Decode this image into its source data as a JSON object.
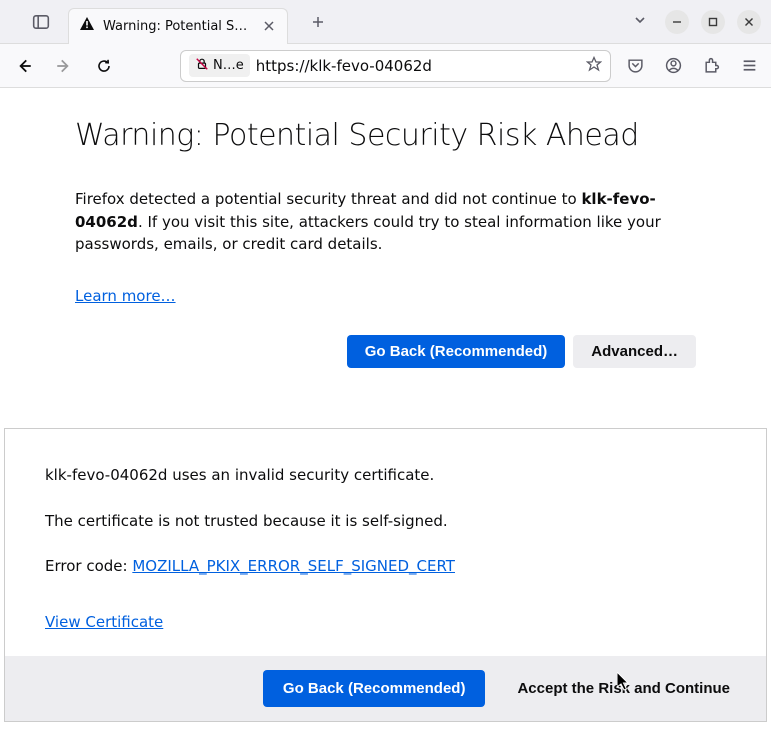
{
  "tab": {
    "title": "Warning: Potential Secur"
  },
  "urlbar": {
    "identity": "N…e",
    "url": "https://klk-fevo-04062d"
  },
  "page": {
    "heading": "Warning: Potential Security Risk Ahead",
    "desc_prefix": "Firefox detected a potential security threat and did not continue to ",
    "desc_host": "klk-fevo-04062d",
    "desc_suffix": ". If you visit this site, attackers could try to steal information like your passwords, emails, or credit card details.",
    "learn_more": "Learn more…",
    "go_back": "Go Back (Recommended)",
    "advanced": "Advanced…"
  },
  "adv": {
    "line1": "klk-fevo-04062d uses an invalid security certificate.",
    "line2": "The certificate is not trusted because it is self-signed.",
    "error_label": "Error code: ",
    "error_code": "MOZILLA_PKIX_ERROR_SELF_SIGNED_CERT",
    "view_cert": "View Certificate",
    "go_back": "Go Back (Recommended)",
    "accept": "Accept the Risk and Continue"
  }
}
